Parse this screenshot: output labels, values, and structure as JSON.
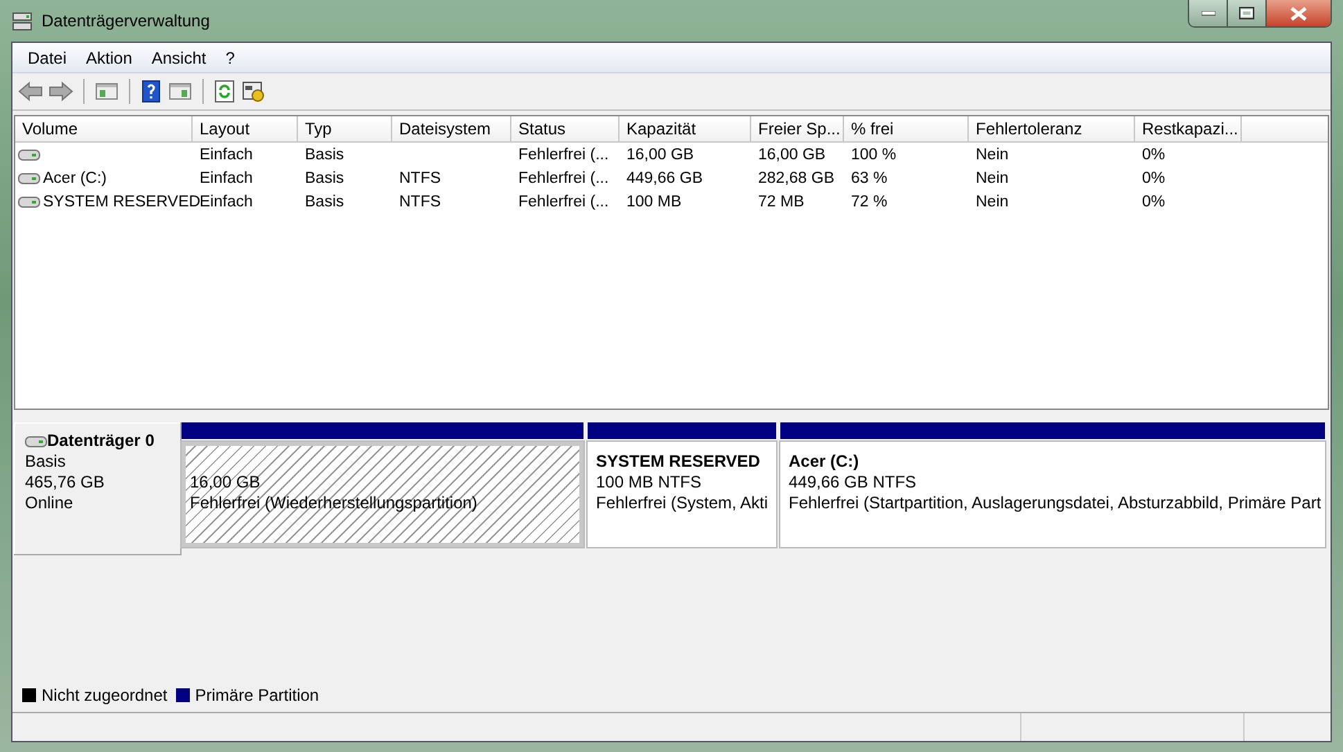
{
  "window": {
    "title": "Datenträgerverwaltung"
  },
  "menu": [
    {
      "label": "Datei"
    },
    {
      "label": "Aktion"
    },
    {
      "label": "Ansicht"
    },
    {
      "label": "?"
    }
  ],
  "toolbar": [
    {
      "kind": "back"
    },
    {
      "kind": "forward"
    },
    {
      "kind": "sep"
    },
    {
      "kind": "pane"
    },
    {
      "kind": "sep"
    },
    {
      "kind": "help"
    },
    {
      "kind": "pane2"
    },
    {
      "kind": "sep"
    },
    {
      "kind": "refresh"
    },
    {
      "kind": "props"
    }
  ],
  "table": {
    "columns": [
      "Volume",
      "Layout",
      "Typ",
      "Dateisystem",
      "Status",
      "Kapazität",
      "Freier Sp...",
      "% frei",
      "Fehlertoleranz",
      "Restkapazi..."
    ],
    "rows": [
      {
        "cells": [
          null,
          "Einfach",
          "Basis",
          null,
          "Fehlerfrei (...",
          "16,00 GB",
          "16,00 GB",
          "100 %",
          "Nein",
          "0%"
        ]
      },
      {
        "cells": [
          "Acer (C:)",
          "Einfach",
          "Basis",
          "NTFS",
          "Fehlerfrei (...",
          "449,66 GB",
          "282,68 GB",
          "63 %",
          "Nein",
          "0%"
        ]
      },
      {
        "cells": [
          "SYSTEM RESERVED",
          "Einfach",
          "Basis",
          "NTFS",
          "Fehlerfrei (...",
          "100 MB",
          "72 MB",
          "72 %",
          "Nein",
          "0%"
        ]
      }
    ]
  },
  "disks": [
    {
      "name": "Datenträger 0",
      "type": "Basis",
      "size": "465,76 GB",
      "state": "Online",
      "partitions": [
        {
          "size": "16,00 GB",
          "status": "Fehlerfrei (Wiederherstellungspartition)",
          "selected": true,
          "color": "#000080"
        },
        {
          "name": "SYSTEM RESERVED",
          "size": "100 MB NTFS",
          "status": "Fehlerfrei (System, Akti",
          "selected": false,
          "color": "#000080"
        },
        {
          "name": "Acer  (C:)",
          "size": "449,66 GB NTFS",
          "status": "Fehlerfrei (Startpartition, Auslagerungsdatei, Absturzabbild, Primäre Part",
          "selected": false,
          "color": "#000080"
        }
      ]
    }
  ],
  "legend": [
    {
      "label": "Nicht zugeordnet",
      "color": "#000000"
    },
    {
      "label": "Primäre Partition",
      "color": "#000080"
    }
  ]
}
